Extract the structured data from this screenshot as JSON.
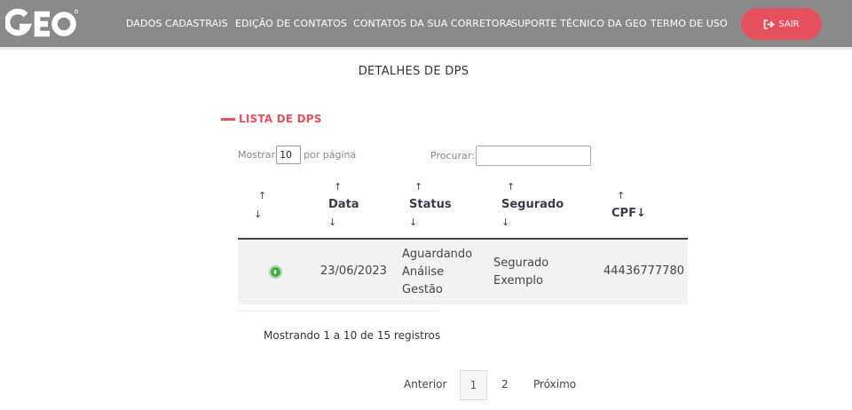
{
  "header": {
    "logo_text": "GEO",
    "nav": [
      {
        "label": "DADOS CADASTRAIS"
      },
      {
        "label": "EDIÇÃO DE CONTATOS"
      },
      {
        "label": "CONTATOS DA SUA CORRETORA"
      },
      {
        "label": "SUPORTE TÉCNICO DA GEO"
      },
      {
        "label": "TERMO DE USO"
      }
    ],
    "logout_label": "SAIR",
    "logout_icon": "sign-out-icon",
    "colors": {
      "bar": "#8a8a8a",
      "accent": "#e5515c"
    }
  },
  "page": {
    "title": "DETALHES DE DPS",
    "section_title": "LISTA DE DPS"
  },
  "controls": {
    "show_label": "Mostrar",
    "page_size": "10",
    "per_page_label": "por página",
    "search_label": "Procurar:",
    "search_value": ""
  },
  "table": {
    "sort_up": "↑",
    "sort_down": "↓",
    "columns": [
      "",
      "Data",
      "Status",
      "Segurado",
      "CPF"
    ],
    "rows": [
      {
        "expand_icon": "plus-circle-icon",
        "data": "23/06/2023",
        "status": [
          "Aguardando",
          "Análise",
          "Gestão"
        ],
        "segurado": [
          "Segurado",
          "Exemplo"
        ],
        "cpf": "44436777780"
      }
    ]
  },
  "footer": {
    "info": "Mostrando 1 a 10 de 15 registros",
    "prev": "Anterior",
    "pages": [
      "1",
      "2"
    ],
    "current_page": "1",
    "next": "Próximo"
  }
}
